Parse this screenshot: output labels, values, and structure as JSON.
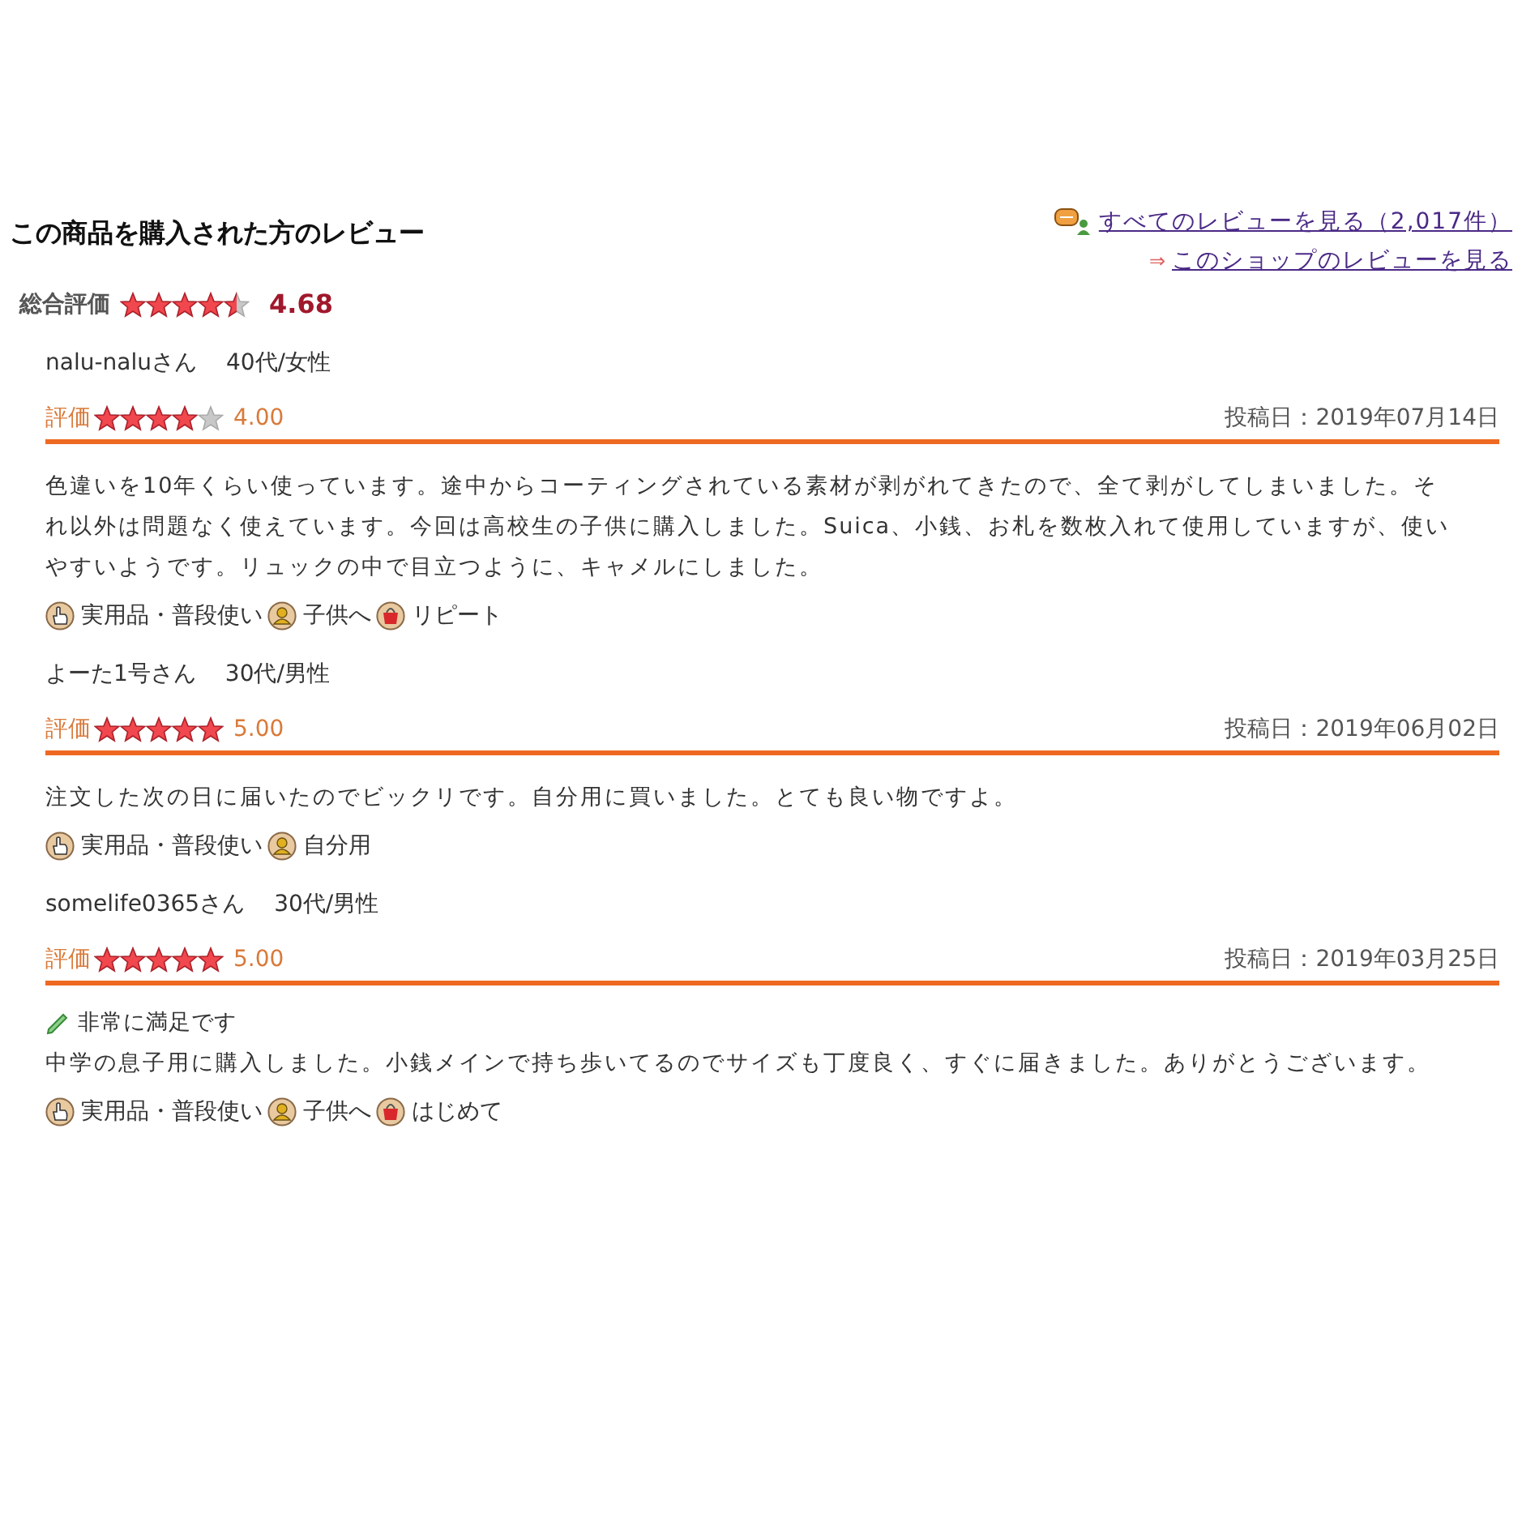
{
  "header": {
    "title": "この商品を購入された方のレビュー",
    "all_reviews_link": "すべてのレビューを見る（2,017件）",
    "shop_arrow": "⇒",
    "shop_reviews_link": "このショップのレビューを見る"
  },
  "overall": {
    "label": "総合評価",
    "stars": 4.5,
    "score": "4.68"
  },
  "reviews": [
    {
      "reviewer": "nalu-naluさん",
      "demographic": "40代/女性",
      "rating_label": "評価",
      "stars": 4,
      "score": "4.00",
      "posted": "投稿日：2019年07月14日",
      "body": "色違いを10年くらい使っています。途中からコーティングされている素材が剥がれてきたので、全て剥がしてしまいました。それ以外は問題なく使えています。今回は高校生の子供に購入しました。Suica、小銭、お札を数枚入れて使用していますが、使いやすいようです。リュックの中で目立つように、キャメルにしました。",
      "tags": [
        {
          "kind": "hand",
          "label": "実用品・普段使い"
        },
        {
          "kind": "person",
          "label": "子供へ"
        },
        {
          "kind": "bag",
          "label": "リピート"
        }
      ]
    },
    {
      "reviewer": "よーた1号さん",
      "demographic": "30代/男性",
      "rating_label": "評価",
      "stars": 5,
      "score": "5.00",
      "posted": "投稿日：2019年06月02日",
      "body": "注文した次の日に届いたのでビックリです。自分用に買いました。とても良い物ですよ。",
      "tags": [
        {
          "kind": "hand",
          "label": "実用品・普段使い"
        },
        {
          "kind": "person",
          "label": "自分用"
        }
      ]
    },
    {
      "reviewer": "somelife0365さん",
      "demographic": "30代/男性",
      "rating_label": "評価",
      "stars": 5,
      "score": "5.00",
      "posted": "投稿日：2019年03月25日",
      "headline": "非常に満足です",
      "body": "中学の息子用に購入しました。小銭メインで持ち歩いてるのでサイズも丁度良く、すぐに届きました。ありがとうございます。",
      "tags": [
        {
          "kind": "hand",
          "label": "実用品・普段使い"
        },
        {
          "kind": "person",
          "label": "子供へ"
        },
        {
          "kind": "bag",
          "label": "はじめて"
        }
      ]
    }
  ]
}
